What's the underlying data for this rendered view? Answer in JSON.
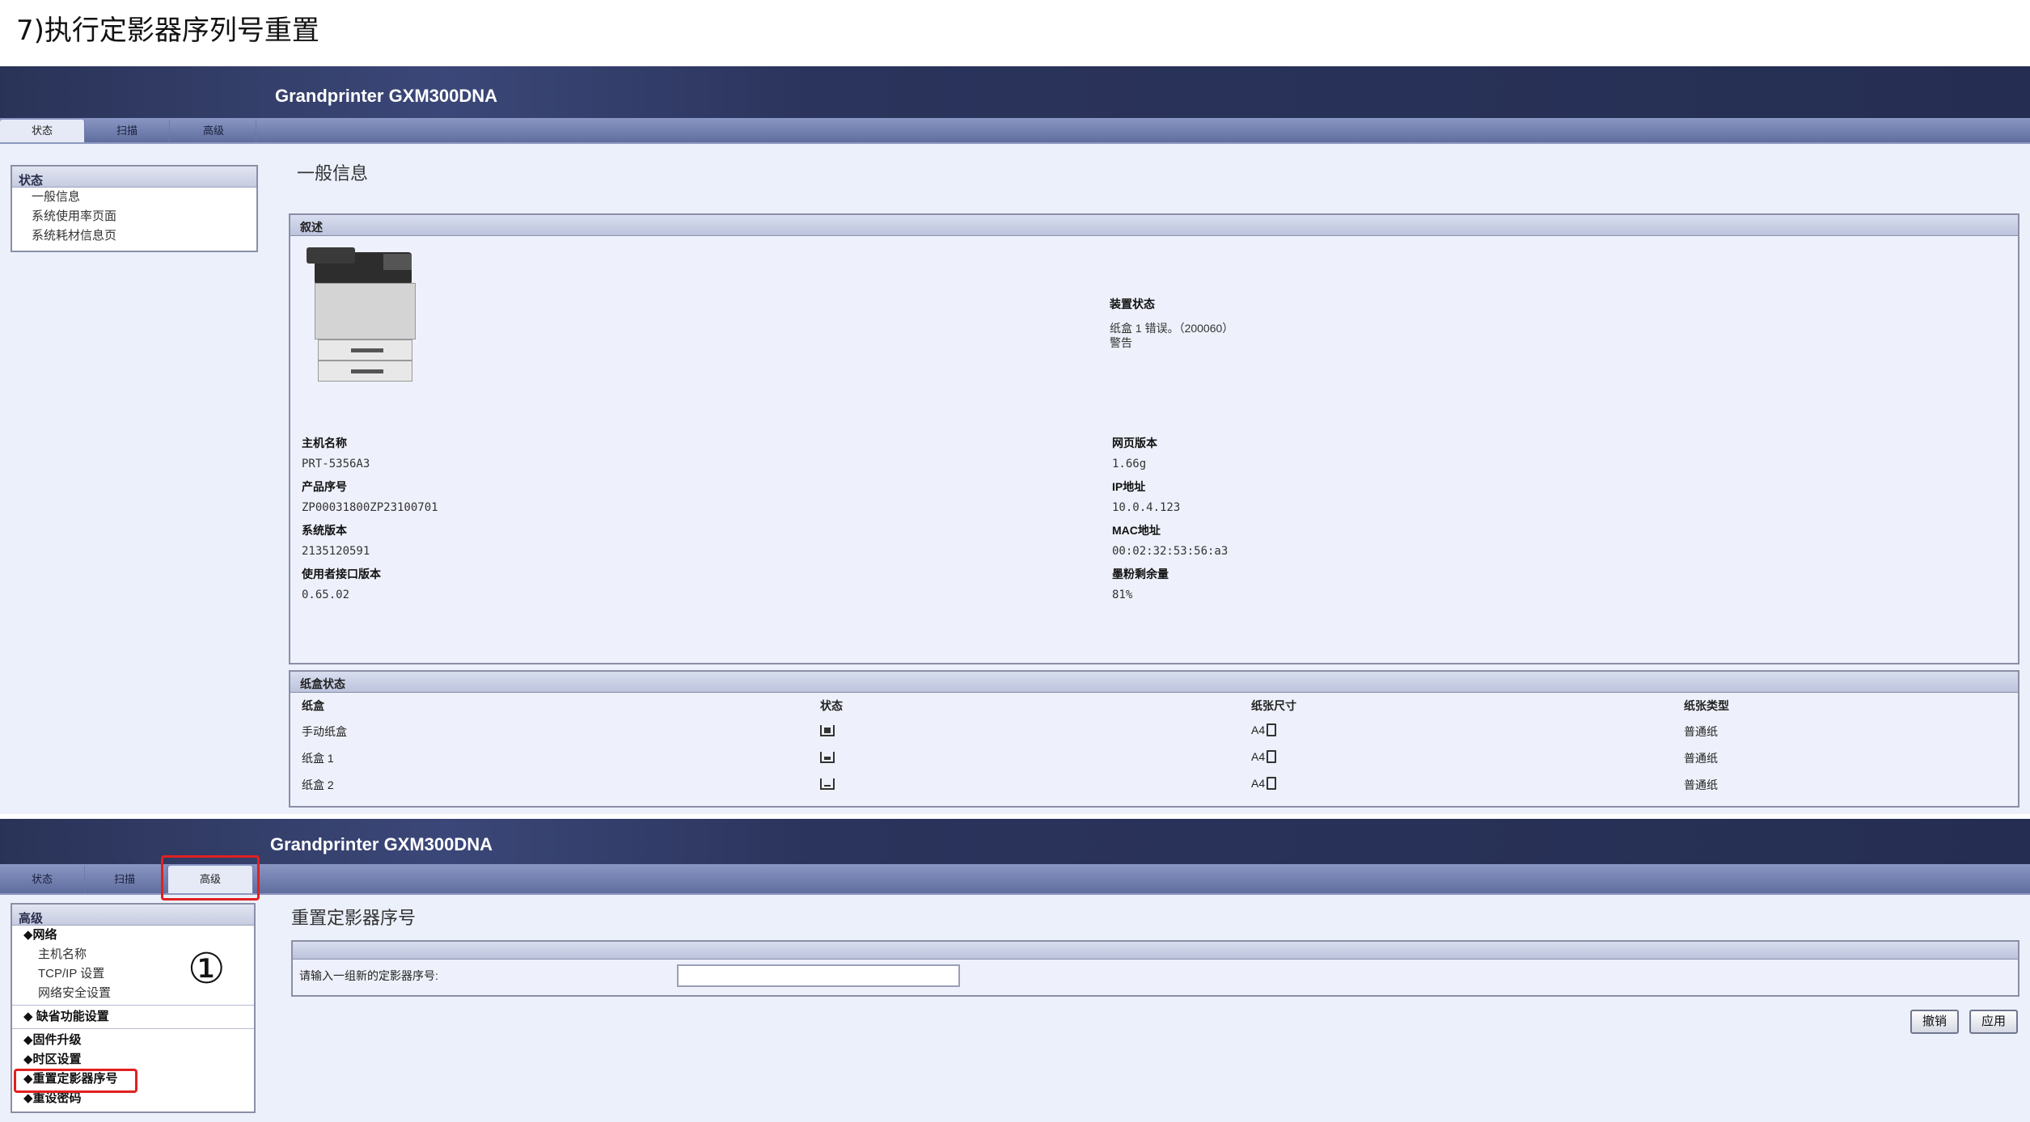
{
  "doc_title": "7)执行定影器序列号重置",
  "brand": "Grandprinter GXM300DNA",
  "tabs": [
    {
      "label": "状态"
    },
    {
      "label": "扫描"
    },
    {
      "label": "高级"
    }
  ],
  "panel1": {
    "sidebar": {
      "heading": "状态",
      "items": [
        "一般信息",
        "系统使用率页面",
        "系统耗材信息页"
      ]
    },
    "page_title": "一般信息",
    "overview": {
      "heading": "叙述",
      "device_status_label": "装置状态",
      "device_status_lines": [
        "纸盒 1 错误。（200060）",
        "警告"
      ],
      "left_fields": [
        {
          "label": "主机名称",
          "value": "PRT-5356A3"
        },
        {
          "label": "产品序号",
          "value": "ZP00031800ZP23100701"
        },
        {
          "label": "系统版本",
          "value": "2135120591"
        },
        {
          "label": "使用者接口版本",
          "value": "0.65.02"
        }
      ],
      "right_fields": [
        {
          "label": "网页版本",
          "value": "1.66g"
        },
        {
          "label": "IP地址",
          "value": "10.0.4.123"
        },
        {
          "label": "MAC地址",
          "value": "00:02:32:53:56:a3"
        },
        {
          "label": "墨粉剩余量",
          "value": "81%"
        }
      ]
    },
    "trays": {
      "heading": "纸盒状态",
      "columns": [
        "纸盒",
        "状态",
        "纸张尺寸",
        "纸张类型"
      ],
      "rows": [
        {
          "name": "手动纸盒",
          "status_icon": "tray-full-icon",
          "size": "A4",
          "type": "普通纸"
        },
        {
          "name": "纸盒 1",
          "status_icon": "tray-mid-icon",
          "size": "A4",
          "type": "普通纸"
        },
        {
          "name": "纸盒 2",
          "status_icon": "tray-low-icon",
          "size": "A4",
          "type": "普通纸"
        }
      ]
    }
  },
  "panel2": {
    "sidebar": {
      "heading": "高级",
      "group_network": "◆网络",
      "network_items": [
        "主机名称",
        "TCP/IP 设置",
        "网络安全设置"
      ],
      "group_default": "◆ 缺省功能设置",
      "group_firmware": "◆固件升级",
      "group_timezone": "◆时区设置",
      "group_reset_fuser": "◆重置定影器序号",
      "group_reset_password": "◆重设密码"
    },
    "annotation": "①",
    "page_title": "重置定影器序号",
    "input_label": "请输入一组新的定影器序号:",
    "input_value": "",
    "cancel_label": "撤销",
    "apply_label": "应用"
  },
  "colors": {
    "header_bg": "#2a3357",
    "tab_strip": "#5f6d9e",
    "content_bg": "#ecf0fb",
    "highlight": "#e02020"
  }
}
